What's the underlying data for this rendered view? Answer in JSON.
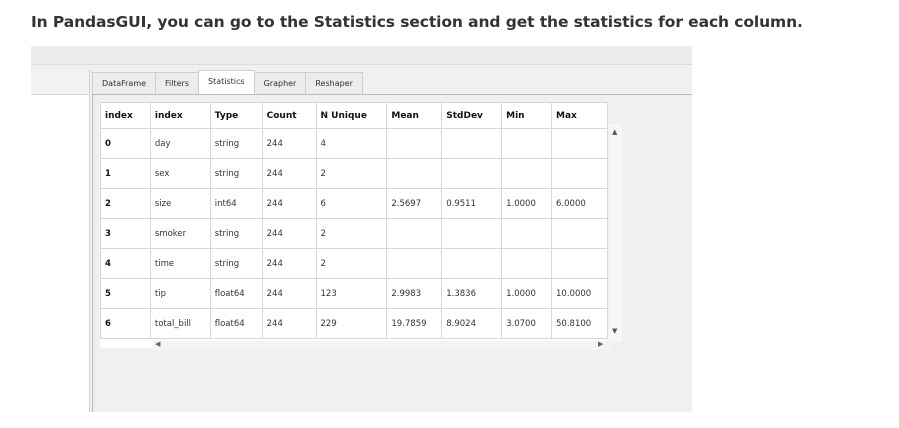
{
  "heading": "In PandasGUI, you can go to the Statistics section and get the statistics for each column.",
  "tabs": [
    {
      "label": "DataFrame",
      "active": false
    },
    {
      "label": "Filters",
      "active": false
    },
    {
      "label": "Statistics",
      "active": true
    },
    {
      "label": "Grapher",
      "active": false
    },
    {
      "label": "Reshaper",
      "active": false
    }
  ],
  "table": {
    "columns": [
      "index",
      "index",
      "Type",
      "Count",
      "N Unique",
      "Mean",
      "StdDev",
      "Min",
      "Max"
    ],
    "rows": [
      [
        "0",
        "day",
        "string",
        "244",
        "4",
        "",
        "",
        "",
        ""
      ],
      [
        "1",
        "sex",
        "string",
        "244",
        "2",
        "",
        "",
        "",
        ""
      ],
      [
        "2",
        "size",
        "int64",
        "244",
        "6",
        "2.5697",
        "0.9511",
        "1.0000",
        "6.0000"
      ],
      [
        "3",
        "smoker",
        "string",
        "244",
        "2",
        "",
        "",
        "",
        ""
      ],
      [
        "4",
        "time",
        "string",
        "244",
        "2",
        "",
        "",
        "",
        ""
      ],
      [
        "5",
        "tip",
        "float64",
        "244",
        "123",
        "2.9983",
        "1.3836",
        "1.0000",
        "10.0000"
      ],
      [
        "6",
        "total_bill",
        "float64",
        "244",
        "229",
        "19.7859",
        "8.9024",
        "3.0700",
        "50.8100"
      ]
    ]
  },
  "scroll": {
    "up_icon": "triangle-up-icon",
    "down_icon": "triangle-down-icon",
    "left_icon": "triangle-left-icon",
    "right_icon": "triangle-right-icon"
  }
}
